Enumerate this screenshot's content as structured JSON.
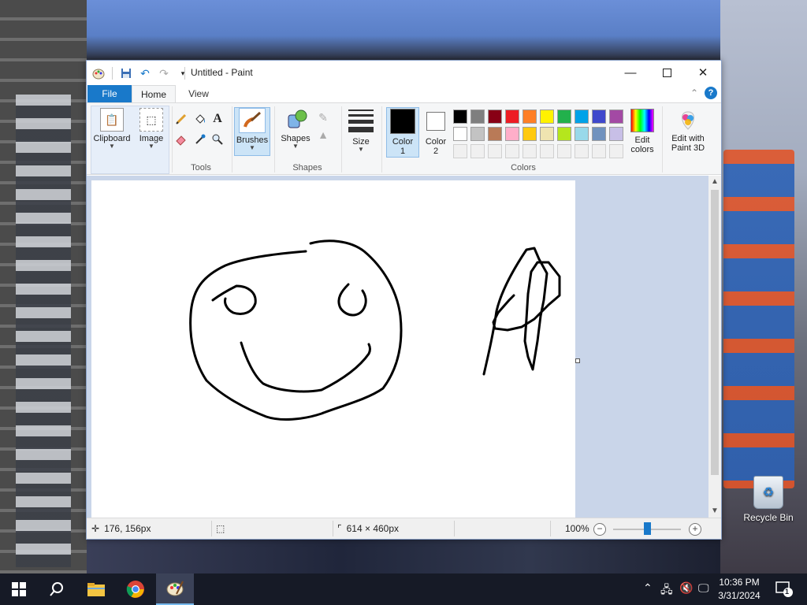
{
  "window": {
    "title": "Untitled - Paint",
    "tabs": {
      "file": "File",
      "home": "Home",
      "view": "View"
    }
  },
  "ribbon": {
    "clipboard": "Clipboard",
    "image": "Image",
    "tools_label": "Tools",
    "brushes": "Brushes",
    "shapes": "Shapes",
    "shapes_group": "Shapes",
    "size": "Size",
    "color1": "Color\n1",
    "color1_line1": "Color",
    "color1_line2": "1",
    "color2_line1": "Color",
    "color2_line2": "2",
    "colors_group": "Colors",
    "edit_colors_line1": "Edit",
    "edit_colors_line2": "colors",
    "paint3d_line1": "Edit with",
    "paint3d_line2": "Paint 3D"
  },
  "palette": {
    "row1": [
      "#000000",
      "#7f7f7f",
      "#880015",
      "#ed1c24",
      "#ff7f27",
      "#fff200",
      "#22b14c",
      "#00a2e8",
      "#3f48cc",
      "#a349a4"
    ],
    "row2": [
      "#ffffff",
      "#c3c3c3",
      "#b97a57",
      "#ffaec9",
      "#ffc90e",
      "#efe4b0",
      "#b5e61d",
      "#99d9ea",
      "#7092be",
      "#c8bfe7"
    ],
    "color1": "#000000",
    "color2": "#ffffff"
  },
  "status": {
    "cursor_pos": "176, 156px",
    "canvas_size": "614 × 460px",
    "zoom": "100%"
  },
  "desktop": {
    "recycle_bin": "Recycle Bin"
  },
  "taskbar": {
    "time": "10:36 PM",
    "date": "3/31/2024",
    "notification_count": "1"
  }
}
